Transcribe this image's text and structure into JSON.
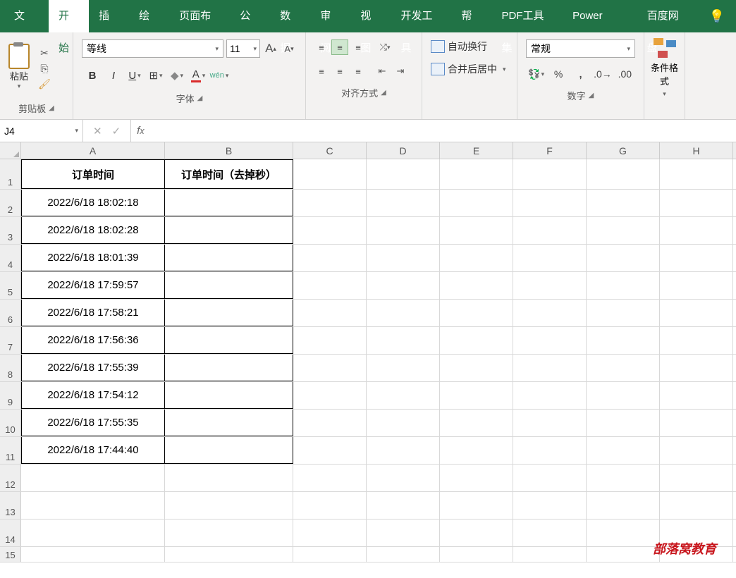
{
  "tabs": {
    "file": "文件",
    "home": "开始",
    "insert": "插入",
    "draw": "绘图",
    "layout": "页面布局",
    "formula": "公式",
    "data": "数据",
    "review": "审阅",
    "view": "视图",
    "dev": "开发工具",
    "help": "帮助",
    "pdf": "PDF工具集",
    "power": "Power Pivot",
    "baidu": "百度网盘"
  },
  "ribbon": {
    "paste": "粘贴",
    "clipboard_label": "剪贴板",
    "font_name": "等线",
    "font_size": "11",
    "font_label": "字体",
    "align_label": "对齐方式",
    "wrap": "自动换行",
    "merge": "合并后居中",
    "number_format": "常规",
    "number_label": "数字",
    "cond_format": "条件格式"
  },
  "namebox": "J4",
  "columns": [
    "A",
    "B",
    "C",
    "D",
    "E",
    "F",
    "G",
    "H"
  ],
  "header_a": "订单时间",
  "header_b": "订单时间（去掉秒）",
  "rows": [
    "2022/6/18 18:02:18",
    "2022/6/18 18:02:28",
    "2022/6/18 18:01:39",
    "2022/6/18 17:59:57",
    "2022/6/18 17:58:21",
    "2022/6/18 17:56:36",
    "2022/6/18 17:55:39",
    "2022/6/18 17:54:12",
    "2022/6/18 17:55:35",
    "2022/6/18 17:44:40"
  ],
  "watermark": "部落窝教育"
}
